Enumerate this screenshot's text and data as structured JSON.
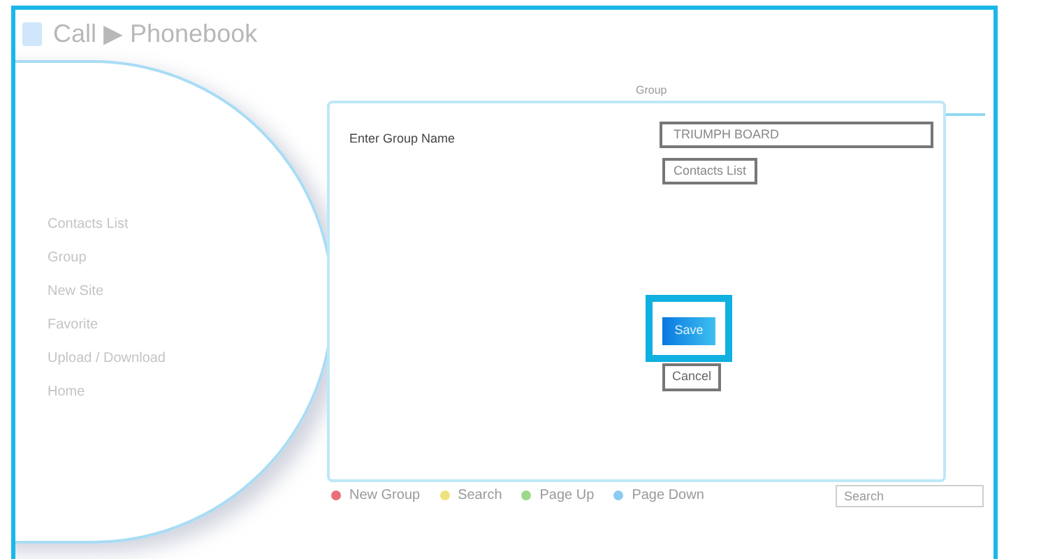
{
  "header": {
    "title": "Call ▶ Phonebook"
  },
  "sidebar": {
    "items": [
      {
        "label": "Contacts List"
      },
      {
        "label": "Group"
      },
      {
        "label": "New Site"
      },
      {
        "label": "Favorite"
      },
      {
        "label": "Upload / Download"
      },
      {
        "label": "Home"
      }
    ]
  },
  "tab": {
    "label": "Group"
  },
  "legend": [
    {
      "label": "New Group",
      "color": "#e8707a"
    },
    {
      "label": "Search",
      "color": "#f0e27a"
    },
    {
      "label": "Page Up",
      "color": "#9ad88a"
    },
    {
      "label": "Page Down",
      "color": "#8ccbf0"
    }
  ],
  "search": {
    "placeholder": "Search"
  },
  "dialog": {
    "label": "Enter Group Name",
    "value": "TRIUMPH BOARD",
    "contacts_button": "Contacts List",
    "save_button": {
      "label": "Save",
      "highlighted": true
    },
    "cancel_button": "Cancel"
  }
}
